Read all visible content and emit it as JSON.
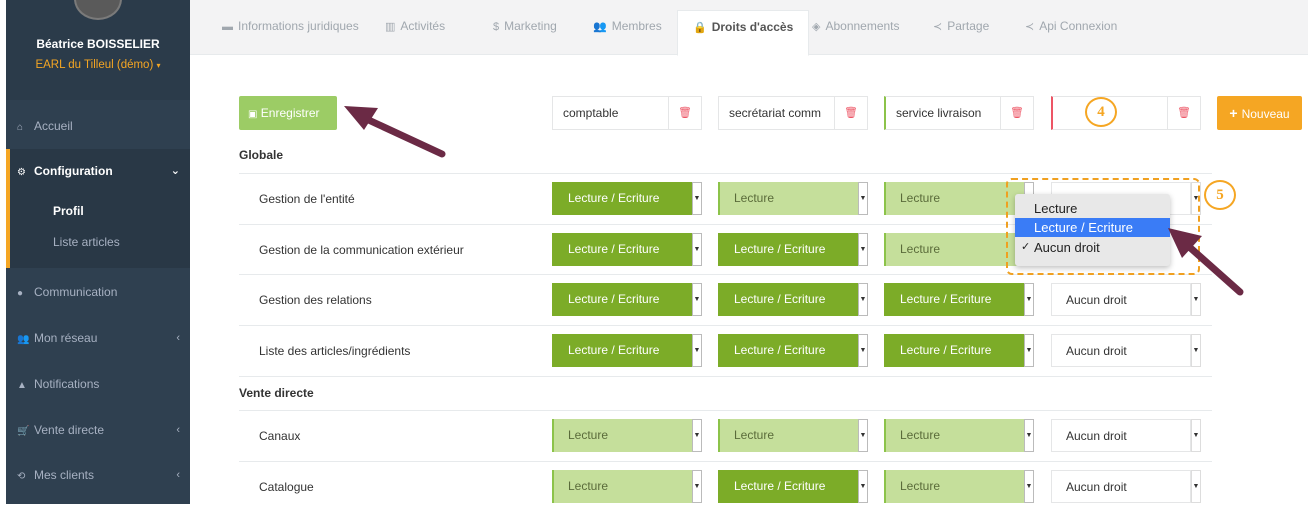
{
  "user": {
    "name": "Béatrice BOISSELIER",
    "org": "EARL du Tilleul (démo)"
  },
  "sidebar": {
    "items": [
      {
        "label": "Accueil",
        "icon": "home-icon"
      },
      {
        "label": "Configuration",
        "icon": "cogs-icon"
      },
      {
        "label": "Communication",
        "icon": "comments-icon"
      },
      {
        "label": "Mon réseau",
        "icon": "users-icon"
      },
      {
        "label": "Notifications",
        "icon": "bell-icon"
      },
      {
        "label": "Vente directe",
        "icon": "cart-icon"
      },
      {
        "label": "Mes clients",
        "icon": "handshake-icon"
      }
    ],
    "sub": [
      "Profil",
      "Liste articles"
    ]
  },
  "tabs": [
    "Informations juridiques",
    "Activités",
    "Marketing",
    "Membres",
    "Droits d'accès",
    "Abonnements",
    "Partage",
    "Api Connexion"
  ],
  "toolbar": {
    "save": "Enregistrer",
    "new": "Nouveau"
  },
  "roles": [
    "comptable",
    "secrétariat comm",
    "service livraison",
    ""
  ],
  "callouts": {
    "four": "4",
    "five": "5"
  },
  "sections": [
    "Globale",
    "Vente directe"
  ],
  "rows": [
    {
      "label": "Gestion de l'entité",
      "values": [
        "Lecture / Ecriture",
        "Lecture",
        "Lecture",
        "Aucun droit"
      ]
    },
    {
      "label": "Gestion de la communication extérieur",
      "values": [
        "Lecture / Ecriture",
        "Lecture / Ecriture",
        "Lecture",
        ""
      ]
    },
    {
      "label": "Gestion des relations",
      "values": [
        "Lecture / Ecriture",
        "Lecture / Ecriture",
        "Lecture / Ecriture",
        "Aucun droit"
      ]
    },
    {
      "label": "Liste des articles/ingrédients",
      "values": [
        "Lecture / Ecriture",
        "Lecture / Ecriture",
        "Lecture / Ecriture",
        "Aucun droit"
      ]
    },
    {
      "label": "Canaux",
      "values": [
        "Lecture",
        "Lecture",
        "Lecture",
        "Aucun droit"
      ]
    },
    {
      "label": "Catalogue",
      "values": [
        "Lecture",
        "Lecture / Ecriture",
        "Lecture",
        "Aucun droit"
      ]
    }
  ],
  "dropdown": {
    "options": [
      "Lecture",
      "Lecture / Ecriture",
      "Aucun droit"
    ],
    "highlighted": "Lecture / Ecriture",
    "checked": "Aucun droit"
  },
  "colors": {
    "sidebar": "#2f4050",
    "accent": "#f5a623",
    "rw": "#7cac28",
    "r": "#c5df9b",
    "highlight": "#3a7cf6",
    "arrow": "#6b2a45"
  }
}
